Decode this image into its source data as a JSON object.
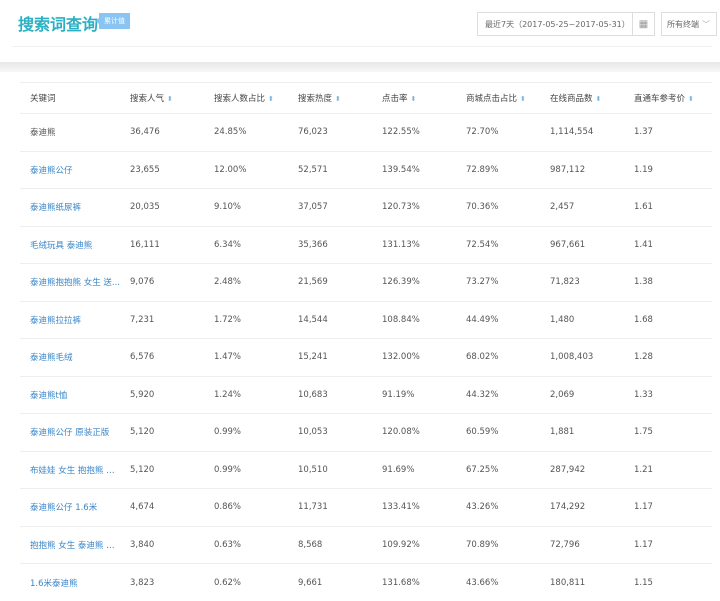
{
  "header": {
    "title": "搜索词查询",
    "badge": "累计值",
    "date_range": "最近7天（2017-05-25~2017-05-31）",
    "calendar_icon": "calendar-icon",
    "terminal_select": "所有终端"
  },
  "table": {
    "columns": [
      "关键词",
      "搜索人气",
      "搜索人数占比",
      "搜索热度",
      "点击率",
      "商城点击占比",
      "在线商品数",
      "直通车参考价"
    ],
    "rows": [
      [
        "泰迪熊",
        "36,476",
        "24.85%",
        "76,023",
        "122.55%",
        "72.70%",
        "1,114,554",
        "1.37"
      ],
      [
        "泰迪熊公仔",
        "23,655",
        "12.00%",
        "52,571",
        "139.54%",
        "72.89%",
        "987,112",
        "1.19"
      ],
      [
        "泰迪熊纸尿裤",
        "20,035",
        "9.10%",
        "37,057",
        "120.73%",
        "70.36%",
        "2,457",
        "1.61"
      ],
      [
        "毛绒玩具 泰迪熊",
        "16,111",
        "6.34%",
        "35,366",
        "131.13%",
        "72.54%",
        "967,661",
        "1.41"
      ],
      [
        "泰迪熊抱抱熊 女生 送...",
        "9,076",
        "2.48%",
        "21,569",
        "126.39%",
        "73.27%",
        "71,823",
        "1.38"
      ],
      [
        "泰迪熊拉拉裤",
        "7,231",
        "1.72%",
        "14,544",
        "108.84%",
        "44.49%",
        "1,480",
        "1.68"
      ],
      [
        "泰迪熊毛绒",
        "6,576",
        "1.47%",
        "15,241",
        "132.00%",
        "68.02%",
        "1,008,403",
        "1.28"
      ],
      [
        "泰迪熊t恤",
        "5,920",
        "1.24%",
        "10,683",
        "91.19%",
        "44.32%",
        "2,069",
        "1.33"
      ],
      [
        "泰迪熊公仔 原装正版",
        "5,120",
        "0.99%",
        "10,053",
        "120.08%",
        "60.59%",
        "1,881",
        "1.75"
      ],
      [
        "布娃娃 女生 抱抱熊 泰...",
        "5,120",
        "0.99%",
        "10,510",
        "91.69%",
        "67.25%",
        "287,942",
        "1.21"
      ],
      [
        "泰迪熊公仔 1.6米",
        "4,674",
        "0.86%",
        "11,731",
        "133.41%",
        "43.26%",
        "174,292",
        "1.17"
      ],
      [
        "抱抱熊 女生 泰迪熊 送...",
        "3,840",
        "0.63%",
        "8,568",
        "109.92%",
        "70.89%",
        "72,796",
        "1.17"
      ],
      [
        "1.6米泰迪熊",
        "3,823",
        "0.62%",
        "9,661",
        "131.68%",
        "43.66%",
        "180,811",
        "1.15"
      ]
    ]
  }
}
